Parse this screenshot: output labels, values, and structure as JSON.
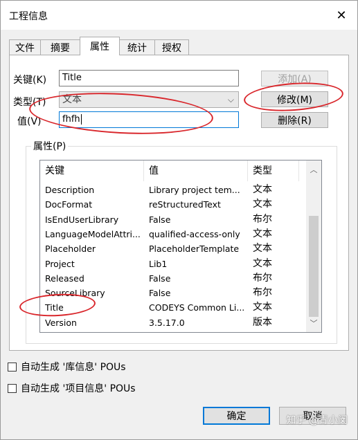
{
  "window": {
    "title": "工程信息",
    "close_glyph": "✕"
  },
  "tabs": [
    {
      "label": "文件",
      "active": false
    },
    {
      "label": "摘要",
      "active": false
    },
    {
      "label": "属性",
      "active": true
    },
    {
      "label": "统计",
      "active": false
    },
    {
      "label": "授权",
      "active": false
    }
  ],
  "form": {
    "key_label": "关键(K)",
    "key_value": "Title",
    "type_label": "类型(T)",
    "type_value": "文本",
    "value_label": "值(V)",
    "value_value": "fhfh"
  },
  "buttons": {
    "add": "添加(A)",
    "modify": "修改(M)",
    "delete": "删除(R)",
    "ok": "确定",
    "cancel": "取消"
  },
  "properties_group": {
    "legend": "属性(P)",
    "columns": [
      "关键",
      "值",
      "类型"
    ],
    "rows": [
      [
        "Description",
        "Library project tem...",
        "文本"
      ],
      [
        "DocFormat",
        "reStructuredText",
        "文本"
      ],
      [
        "IsEndUserLibrary",
        "False",
        "布尔"
      ],
      [
        "LanguageModelAttri...",
        "qualified-access-only",
        "文本"
      ],
      [
        "Placeholder",
        "PlaceholderTemplate",
        "文本"
      ],
      [
        "Project",
        "Lib1",
        "文本"
      ],
      [
        "Released",
        "False",
        "布尔"
      ],
      [
        "SourceLibrary",
        "False",
        "布尔"
      ],
      [
        "Title",
        "CODEYS Common Li...",
        "文本"
      ],
      [
        "Version",
        "3.5.17.0",
        "版本"
      ]
    ]
  },
  "checkboxes": [
    {
      "label": "自动生成 '库信息' POUs",
      "checked": false
    },
    {
      "label": "自动生成 '项目信息' POUs",
      "checked": false
    }
  ],
  "watermark": "知乎 @青小闵",
  "colors": {
    "annotation": "#d9262b",
    "focus": "#0078d7"
  }
}
